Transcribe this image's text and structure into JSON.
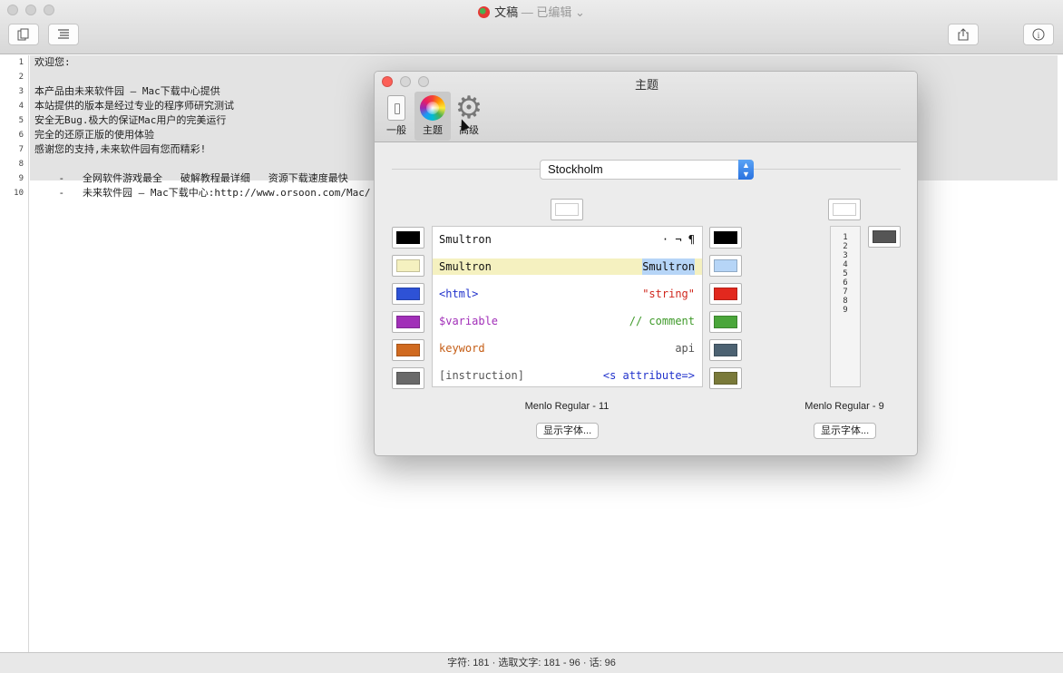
{
  "window": {
    "title": "文稿",
    "title_suffix": " — 已编辑 ⌄",
    "toolbar": {
      "left_buttons": [
        "duplicate-icon",
        "list-icon"
      ],
      "right_buttons": [
        "share-icon",
        "info-icon"
      ]
    }
  },
  "editor": {
    "line_numbers": [
      "1",
      "2",
      "3",
      "4",
      "5",
      "6",
      "7",
      "8",
      "9",
      "10"
    ],
    "lines": [
      "欢迎您:",
      "",
      "本产品由未来软件园 — Mac下载中心提供",
      "本站提供的版本是经过专业的程序师研究测试",
      "安全无Bug.极大的保证Mac用户的完美运行",
      "完全的还原正版的使用体验",
      "感谢您的支持,未来软件园有您而精彩!",
      "",
      "    -   全网软件游戏最全   破解教程最详细   资源下载速度最快",
      "    -   未来软件园 — Mac下载中心:http://www.orsoon.com/Mac/"
    ]
  },
  "status_bar": "字符: 181 · 选取文字: 181 - 96 · 话: 96",
  "prefs": {
    "title": "主题",
    "tabs": [
      {
        "label": "一般",
        "icon": "switch-icon"
      },
      {
        "label": "主题",
        "icon": "color-wheel-icon"
      },
      {
        "label": "高级",
        "icon": "gear-icon"
      }
    ],
    "active_tab": "主题",
    "theme_select": "Stockholm",
    "preview": [
      {
        "left": "Smultron",
        "right": "· ¬ ¶",
        "left_color": "#111111",
        "right_color": "#111111"
      },
      {
        "left": "Smultron",
        "right": "Smultron",
        "left_color": "#111111",
        "right_color": "#111111"
      },
      {
        "left": "<html>",
        "right": "\"string\"",
        "left_color": "#2233cc",
        "right_color": "#d0271d"
      },
      {
        "left": "$variable",
        "right": "// comment",
        "left_color": "#a12fb8",
        "right_color": "#3f9a2a"
      },
      {
        "left": "keyword",
        "right": "api",
        "left_color": "#c55d15",
        "right_color": "#555555"
      },
      {
        "left": "[instruction]",
        "right": "<s attribute=>",
        "left_color": "#555555",
        "right_color": "#2233cc"
      }
    ],
    "left_wells": [
      "#000000",
      "#f5f1c0",
      "#2e52d6",
      "#a12fb8",
      "#d06a20",
      "#6a6a6a"
    ],
    "right_wells": [
      "#000000",
      "#b6d5f7",
      "#e2281e",
      "#4aa63a",
      "#4c6272",
      "#7a7a3a"
    ],
    "top_well": "#ffffff",
    "line_panel_top_well": "#ffffff",
    "line_panel_side_well": "#555555",
    "line_panel_numbers": [
      "1",
      "2",
      "3",
      "4",
      "5",
      "6",
      "7",
      "8",
      "9"
    ],
    "font_label_left": "Menlo Regular - 11",
    "font_label_right": "Menlo Regular - 9",
    "show_font_label": "显示字体..."
  }
}
